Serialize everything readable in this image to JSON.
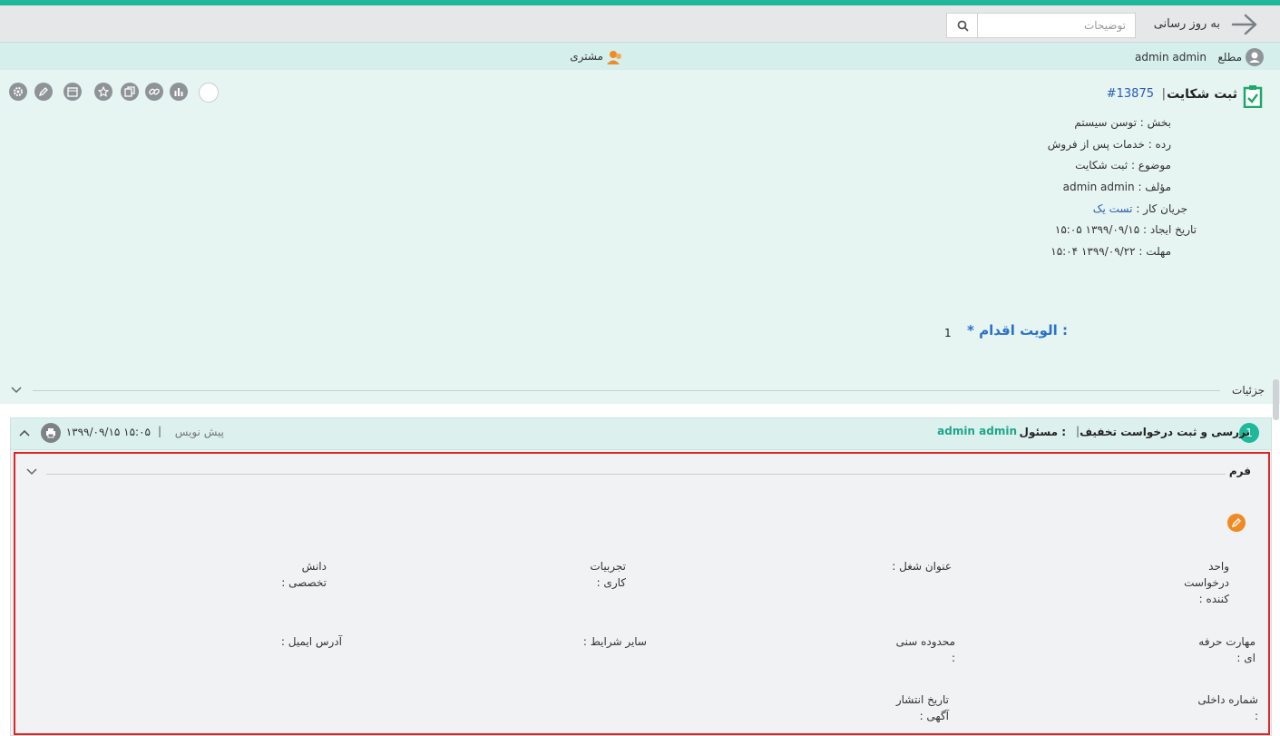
{
  "toolbar": {
    "refresh_label": "به روز رسانی",
    "search_placeholder": "توضیحات"
  },
  "infobar": {
    "informed_label": "مطلع",
    "informed_user": "admin admin",
    "customer_label": "مشتری"
  },
  "ticket": {
    "title": "ثبت شکایت",
    "separator": "|",
    "id": "#13875",
    "fields": [
      {
        "label": "بخش :",
        "value": "توسن سیستم"
      },
      {
        "label": "رده :",
        "value": "خدمات پس از فروش"
      },
      {
        "label": "موضوع :",
        "value": "ثبت شکایت"
      },
      {
        "label": "مؤلف :",
        "value": "admin admin"
      },
      {
        "label": "جریان کار :",
        "value": "تست یک"
      },
      {
        "label": "تاریخ ایجاد :",
        "value": "۱۳۹۹/۰۹/۱۵ ۱۵:۰۵"
      },
      {
        "label": "مهلت :",
        "value": "۱۳۹۹/۰۹/۲۲ ۱۵:۰۴"
      }
    ],
    "priority_label": "* الویت اقدام :",
    "priority_value": "1"
  },
  "details": {
    "label": "جزئیات"
  },
  "step": {
    "number": "1",
    "title": "بررسی و ثبت درخواست تخفیف",
    "separator": "|",
    "responsible_label": "مسئول :",
    "responsible_user": "admin admin",
    "status": "پیش نویس",
    "date": "۱۳۹۹/۰۹/۱۵ ۱۵:۰۵"
  },
  "form": {
    "label": "فرم",
    "fields": [
      {
        "line1": "واحد",
        "line2": "درخواست",
        "line3": "کننده :"
      },
      {
        "line1": "عنوان شغل :"
      },
      {
        "line1": "تجربیات",
        "line2": "کاری :"
      },
      {
        "line1": "دانش",
        "line2": "تخصصی :"
      },
      {
        "line1": "مهارت حرفه",
        "line2": "ای :"
      },
      {
        "line1": "محدوده سنی",
        "line2": ":"
      },
      {
        "line1": "سایر شرایط :"
      },
      {
        "line1": "آدرس ایمیل :"
      },
      {
        "line1": "شماره داخلی",
        "line2": ":"
      },
      {
        "line1": "تاریخ انتشار",
        "line2": "آگهی :"
      }
    ]
  },
  "colors": {
    "accent": "#1fb89a",
    "highlight_border": "#e02426",
    "link": "#2a5db0",
    "priority": "#2a72c9",
    "edit": "#f08a24"
  }
}
